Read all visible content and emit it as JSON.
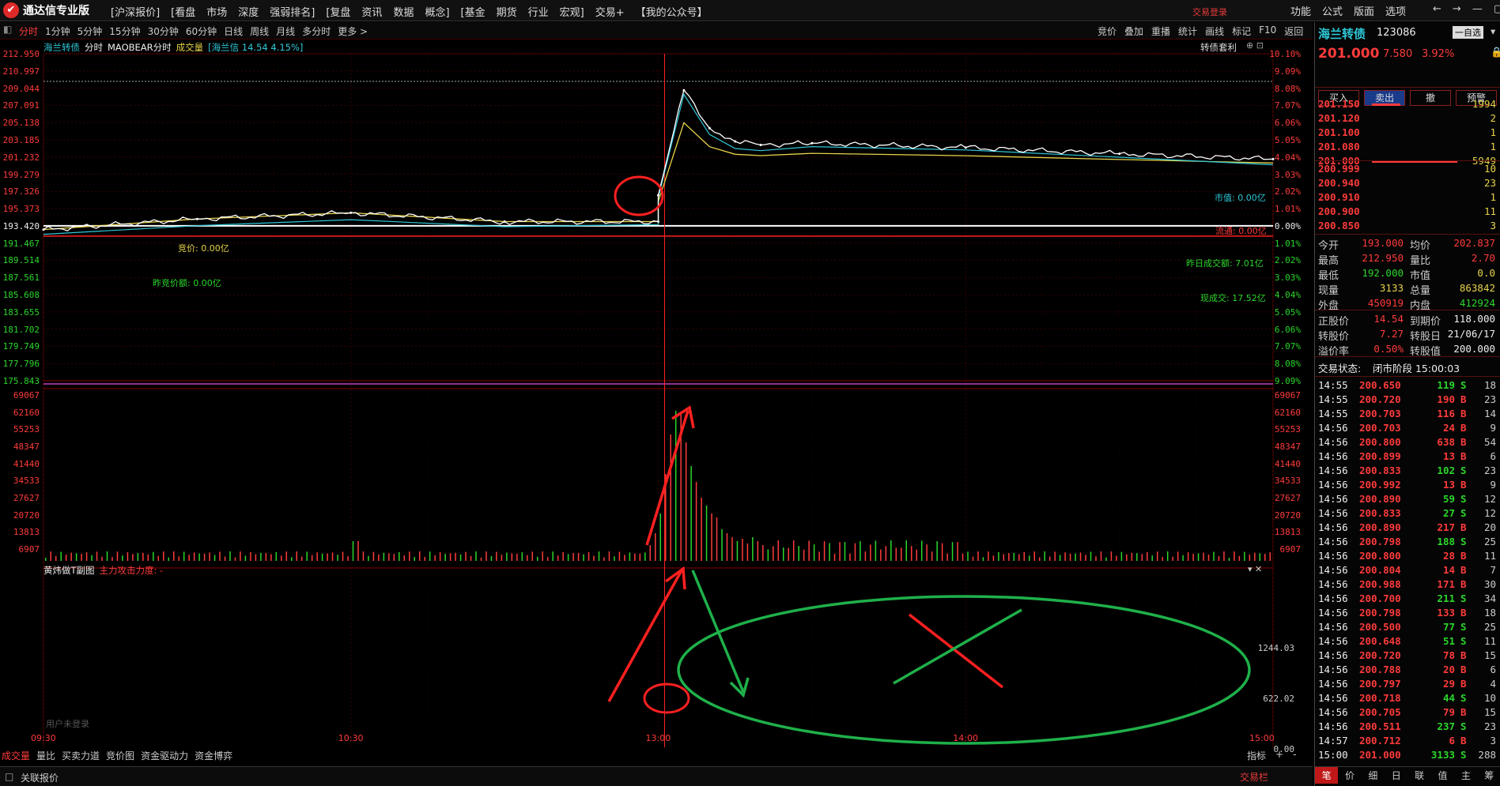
{
  "app": {
    "title": "通达信专业版",
    "logo_icon": "tdx-logo-icon"
  },
  "menubar": {
    "items": [
      "[沪深报价]",
      "[看盘",
      "市场",
      "深度",
      "强弱排名]",
      "[复盘",
      "资讯",
      "数据",
      "概念]",
      "[基金",
      "期货",
      "行业",
      "宏观]",
      "交易+",
      "【我的公众号】"
    ],
    "login": "交易登录",
    "right": [
      "功能",
      "公式",
      "版面",
      "选项"
    ]
  },
  "timeframes": [
    "分时",
    "1分钟",
    "5分钟",
    "15分钟",
    "30分钟",
    "60分钟",
    "日线",
    "周线",
    "月线",
    "多分时",
    "更多 >"
  ],
  "tools": [
    "竞价",
    "叠加",
    "重播",
    "统计",
    "画线",
    "标记",
    "F10",
    "返回"
  ],
  "chart": {
    "name": "海兰转债",
    "mode": "分时",
    "indicator": "MAOBEAR分时",
    "vol_label": "成交量",
    "stock_info": "[海兰信 14.54 4.15%]",
    "arb_label": "转债套利",
    "price_ticks": [
      "212.950",
      "210.997",
      "209.044",
      "207.091",
      "205.138",
      "203.185",
      "201.232",
      "199.279",
      "197.326",
      "195.373",
      "193.420",
      "191.467",
      "189.514",
      "187.561",
      "185.608",
      "183.655",
      "181.702",
      "179.749",
      "177.796",
      "175.843"
    ],
    "pct_ticks": [
      "10.10%",
      "9.09%",
      "8.08%",
      "7.07%",
      "6.06%",
      "5.05%",
      "4.04%",
      "3.03%",
      "2.02%",
      "1.01%",
      "0.00%",
      "1.01%",
      "2.02%",
      "3.03%",
      "4.04%",
      "5.05%",
      "6.06%",
      "7.07%",
      "8.08%",
      "9.09%"
    ],
    "vol_ticks": [
      "69067",
      "62160",
      "55253",
      "48347",
      "41440",
      "34533",
      "27627",
      "20720",
      "13813",
      "6907"
    ],
    "annotations": {
      "market_cap": "市值: 0.00亿",
      "float": "流通: 0.00亿",
      "yesterday_turnover": "昨日成交额: 7.01亿",
      "current_turnover": "现成交: 17.52亿",
      "auction_price": "竞价: 0.00亿",
      "yesterday_auction": "昨竞价额: 0.00亿"
    },
    "sub_indicator": "黄炜做T副图",
    "sub_label": "主力攻击力度: -",
    "sub_ticks": [
      "1244.03",
      "622.02",
      "0.00"
    ],
    "sub_hint": "用户未登录",
    "time_labels": [
      "09:30",
      "10:30",
      "13:00",
      "14:00",
      "15:00"
    ],
    "colors": {
      "price_line": "#ffffff",
      "avg_line": "#e8d44a",
      "overlay_line": "#2ec8d8",
      "axis": "#ff3b3b",
      "up": "#ff3b3b",
      "down": "#2bd72b"
    }
  },
  "chart_data": {
    "type": "line",
    "x": [
      "09:30",
      "10:00",
      "10:30",
      "11:00",
      "11:30",
      "13:00",
      "13:05",
      "13:10",
      "13:15",
      "13:20",
      "13:30",
      "14:00",
      "14:30",
      "15:00"
    ],
    "series": [
      {
        "name": "海兰转债",
        "values": [
          193.0,
          194.2,
          194.9,
          193.9,
          193.9,
          196.9,
          208.8,
          204.5,
          203.0,
          202.6,
          202.8,
          202.3,
          201.6,
          201.0
        ]
      }
    ],
    "ylim": [
      175.843,
      212.95
    ]
  },
  "bottom_tabs": [
    "成交量",
    "量比",
    "买卖力道",
    "竞价图",
    "资金驱动力",
    "资金博弈"
  ],
  "bottom_right": [
    "指标",
    "+",
    "-"
  ],
  "status": {
    "left": "关联报价",
    "right": "交易栏"
  },
  "side": {
    "name": "海兰转债",
    "code": "123086",
    "tag": "一自选",
    "price": "201.000",
    "change": "7.580",
    "change_pct": "3.92%",
    "buttons": [
      "买入",
      "卖出",
      "撤",
      "预警"
    ],
    "asks": [
      {
        "price": "201.150",
        "vol": "1994"
      },
      {
        "price": "201.120",
        "vol": "2"
      },
      {
        "price": "201.100",
        "vol": "1"
      },
      {
        "price": "201.080",
        "vol": "1"
      },
      {
        "price": "201.000",
        "vol": "5949"
      }
    ],
    "bids": [
      {
        "price": "200.999",
        "vol": "10"
      },
      {
        "price": "200.940",
        "vol": "23"
      },
      {
        "price": "200.910",
        "vol": "1"
      },
      {
        "price": "200.900",
        "vol": "11"
      },
      {
        "price": "200.850",
        "vol": "3"
      }
    ],
    "stats": [
      [
        "今开",
        "193.000",
        "均价",
        "202.837"
      ],
      [
        "最高",
        "212.950",
        "量比",
        "2.70"
      ],
      [
        "最低",
        "192.000",
        "市值",
        "0.0"
      ],
      [
        "现量",
        "3133",
        "总量",
        "863842"
      ],
      [
        "外盘",
        "450919",
        "内盘",
        "412924"
      ]
    ],
    "bond": [
      [
        "正股价",
        "14.54",
        "到期价",
        "118.000"
      ],
      [
        "转股价",
        "7.27",
        "转股日",
        "21/06/17"
      ],
      [
        "溢价率",
        "0.50%",
        "转股值",
        "200.000"
      ]
    ],
    "trade_status_label": "交易状态:",
    "trade_status": "闭市阶段 15:00:03",
    "ticks": [
      [
        "14:55",
        "200.650",
        "119",
        "S",
        "18"
      ],
      [
        "14:55",
        "200.720",
        "190",
        "B",
        "23"
      ],
      [
        "14:55",
        "200.703",
        "116",
        "B",
        "14"
      ],
      [
        "14:56",
        "200.703",
        "24",
        "B",
        "9"
      ],
      [
        "14:56",
        "200.800",
        "638",
        "B",
        "54"
      ],
      [
        "14:56",
        "200.899",
        "13",
        "B",
        "6"
      ],
      [
        "14:56",
        "200.833",
        "102",
        "S",
        "23"
      ],
      [
        "14:56",
        "200.992",
        "13",
        "B",
        "9"
      ],
      [
        "14:56",
        "200.890",
        "59",
        "S",
        "12"
      ],
      [
        "14:56",
        "200.833",
        "27",
        "S",
        "12"
      ],
      [
        "14:56",
        "200.890",
        "217",
        "B",
        "20"
      ],
      [
        "14:56",
        "200.798",
        "188",
        "S",
        "25"
      ],
      [
        "14:56",
        "200.800",
        "28",
        "B",
        "11"
      ],
      [
        "14:56",
        "200.804",
        "14",
        "B",
        "7"
      ],
      [
        "14:56",
        "200.988",
        "171",
        "B",
        "30"
      ],
      [
        "14:56",
        "200.700",
        "211",
        "S",
        "34"
      ],
      [
        "14:56",
        "200.798",
        "133",
        "B",
        "18"
      ],
      [
        "14:56",
        "200.500",
        "77",
        "S",
        "25"
      ],
      [
        "14:56",
        "200.648",
        "51",
        "S",
        "11"
      ],
      [
        "14:56",
        "200.720",
        "78",
        "B",
        "15"
      ],
      [
        "14:56",
        "200.788",
        "20",
        "B",
        "6"
      ],
      [
        "14:56",
        "200.797",
        "29",
        "B",
        "4"
      ],
      [
        "14:56",
        "200.718",
        "44",
        "S",
        "10"
      ],
      [
        "14:56",
        "200.705",
        "79",
        "B",
        "15"
      ],
      [
        "14:56",
        "200.511",
        "237",
        "S",
        "23"
      ],
      [
        "14:57",
        "200.712",
        "6",
        "B",
        "3"
      ],
      [
        "15:00",
        "201.000",
        "3133",
        "S",
        "288"
      ]
    ],
    "bottom_tabs": [
      "笔",
      "价",
      "细",
      "日",
      "联",
      "值",
      "主",
      "筹"
    ]
  }
}
